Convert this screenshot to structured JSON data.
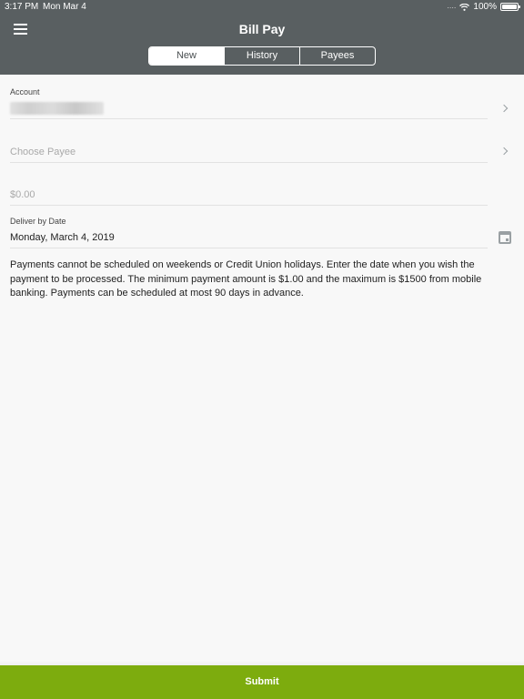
{
  "status_bar": {
    "time": "3:17 PM",
    "date": "Mon Mar 4",
    "battery": "100%"
  },
  "header": {
    "title": "Bill Pay",
    "menu_icon": "hamburger-menu-icon",
    "tabs": [
      {
        "label": "New",
        "active": true
      },
      {
        "label": "History",
        "active": false
      },
      {
        "label": "Payees",
        "active": false
      }
    ]
  },
  "form": {
    "account": {
      "label": "Account",
      "value_obscured": true
    },
    "payee": {
      "placeholder": "Choose Payee"
    },
    "amount": {
      "placeholder": "$0.00"
    },
    "deliver_by": {
      "label": "Deliver by Date",
      "value": "Monday, March 4, 2019",
      "icon": "calendar-icon"
    }
  },
  "info_text": "Payments cannot be scheduled on weekends or Credit Union holidays. Enter the date when you wish the payment to be processed. The minimum payment amount is $1.00 and the maximum is $1500 from mobile banking. Payments can be scheduled at most 90 days in advance.",
  "submit": {
    "label": "Submit"
  },
  "colors": {
    "header_bg": "#595f61",
    "submit_bg": "#7dac0e",
    "page_bg": "#f8f8f8"
  }
}
